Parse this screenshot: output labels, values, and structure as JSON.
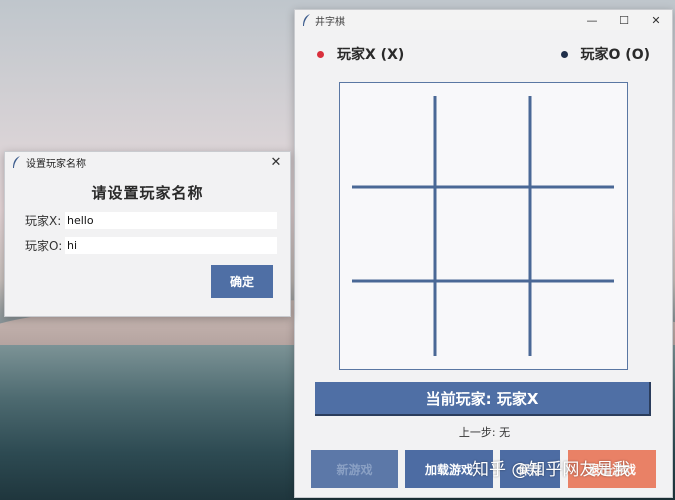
{
  "game_window": {
    "title": "井字棋",
    "minimize": "—",
    "maximize": "☐",
    "close": "✕",
    "player_x": {
      "label": "玩家X (X)",
      "dot_color": "#d9303c"
    },
    "player_o": {
      "label": "玩家O (O)",
      "dot_color": "#1f2f4a"
    },
    "board": {
      "rows": 3,
      "cols": 3,
      "cells": [
        "",
        "",
        "",
        "",
        "",
        "",
        "",
        "",
        ""
      ]
    },
    "current_player": "当前玩家: 玩家X",
    "last_move": "上一步: 无",
    "buttons": {
      "new_game": "新游戏",
      "load_game": "加载游戏",
      "save_game": "保存",
      "exit_game": "退出游戏"
    }
  },
  "dialog": {
    "title": "设置玩家名称",
    "close": "✕",
    "heading": "请设置玩家名称",
    "player_x_label": "玩家X:",
    "player_x_value": "hello",
    "player_o_label": "玩家O:",
    "player_o_value": "hi",
    "confirm": "确定"
  },
  "watermark": "知乎 @知乎网友是我",
  "colors": {
    "accent": "#4f6fa5",
    "exit": "#e98166",
    "grid": "#4a6896"
  }
}
